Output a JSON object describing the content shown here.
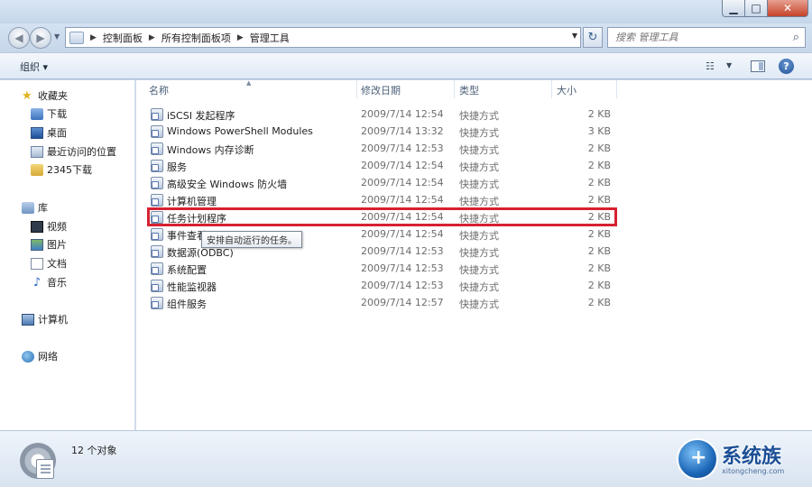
{
  "window": {
    "minimize": "▁",
    "maximize": "□",
    "close": "✕"
  },
  "address": {
    "crumbs": [
      "控制面板",
      "所有控制面板项",
      "管理工具"
    ],
    "search_placeholder": "搜索 管理工具"
  },
  "toolbar": {
    "organize": "组织 ▾"
  },
  "nav": {
    "favorites": "收藏夹",
    "favorites_items": [
      "下载",
      "桌面",
      "最近访问的位置",
      "2345下载"
    ],
    "libraries": "库",
    "library_items": [
      "视频",
      "图片",
      "文档",
      "音乐"
    ],
    "computer": "计算机",
    "network": "网络"
  },
  "list": {
    "columns": [
      "名称",
      "修改日期",
      "类型",
      "大小"
    ],
    "rows": [
      {
        "name": "iSCSI 发起程序",
        "date": "2009/7/14 12:54",
        "type": "快捷方式",
        "size": "2 KB"
      },
      {
        "name": "Windows PowerShell Modules",
        "date": "2009/7/14 13:32",
        "type": "快捷方式",
        "size": "3 KB"
      },
      {
        "name": "Windows 内存诊断",
        "date": "2009/7/14 12:53",
        "type": "快捷方式",
        "size": "2 KB"
      },
      {
        "name": "服务",
        "date": "2009/7/14 12:54",
        "type": "快捷方式",
        "size": "2 KB"
      },
      {
        "name": "高级安全 Windows 防火墙",
        "date": "2009/7/14 12:54",
        "type": "快捷方式",
        "size": "2 KB"
      },
      {
        "name": "计算机管理",
        "date": "2009/7/14 12:54",
        "type": "快捷方式",
        "size": "2 KB"
      },
      {
        "name": "任务计划程序",
        "date": "2009/7/14 12:54",
        "type": "快捷方式",
        "size": "2 KB"
      },
      {
        "name": "事件查看器",
        "date": "2009/7/14 12:54",
        "type": "快捷方式",
        "size": "2 KB"
      },
      {
        "name": "数据源(ODBC)",
        "date": "2009/7/14 12:53",
        "type": "快捷方式",
        "size": "2 KB"
      },
      {
        "name": "系统配置",
        "date": "2009/7/14 12:53",
        "type": "快捷方式",
        "size": "2 KB"
      },
      {
        "name": "性能监视器",
        "date": "2009/7/14 12:53",
        "type": "快捷方式",
        "size": "2 KB"
      },
      {
        "name": "组件服务",
        "date": "2009/7/14 12:57",
        "type": "快捷方式",
        "size": "2 KB"
      }
    ],
    "tooltip": "安排自动运行的任务。",
    "highlight_color": "#d62130"
  },
  "details": {
    "count": "12 个对象"
  },
  "watermark": {
    "brand": "系统族",
    "url": "xitongcheng.com"
  }
}
